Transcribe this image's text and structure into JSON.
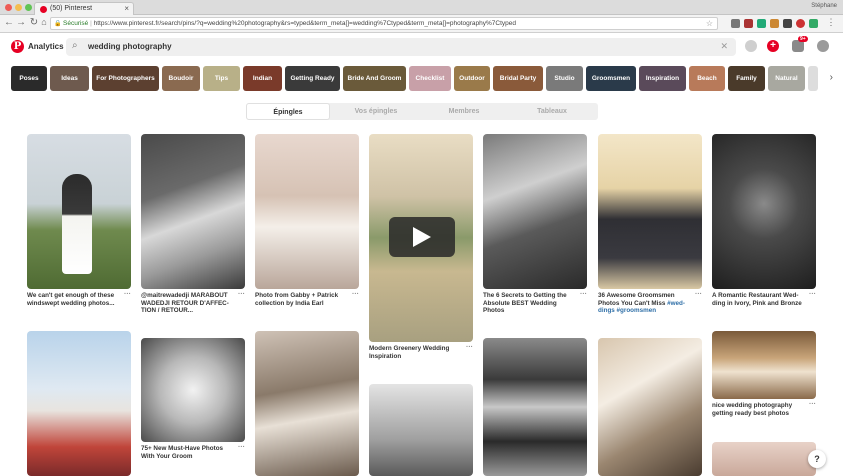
{
  "browser": {
    "tab_title": "(50) Pinterest",
    "user": "Stéphane",
    "secure_label": "Sécurisé",
    "url": "https://www.pinterest.fr/search/pins/?q=wedding%20photography&rs=typed&term_meta[]=wedding%7Ctyped&term_meta[]=photography%7Ctyped"
  },
  "header": {
    "analytics_label": "Analytics",
    "search_value": "wedding photography",
    "notification_badge": "9+"
  },
  "guides": [
    {
      "label": "Poses",
      "color": "#2a2a2a"
    },
    {
      "label": "Ideas",
      "color": "#6e5a4e"
    },
    {
      "label": "For Photographers",
      "color": "#5c4030"
    },
    {
      "label": "Boudoir",
      "color": "#8a6a50"
    },
    {
      "label": "Tips",
      "color": "#b8b088"
    },
    {
      "label": "Indian",
      "color": "#7a3a2a"
    },
    {
      "label": "Getting Ready",
      "color": "#3a3a3a"
    },
    {
      "label": "Bride And Groom",
      "color": "#6a5a3a"
    },
    {
      "label": "Checklist",
      "color": "#c8a0a8"
    },
    {
      "label": "Outdoor",
      "color": "#9a7a4a"
    },
    {
      "label": "Bridal Party",
      "color": "#8a5a3a"
    },
    {
      "label": "Studio",
      "color": "#7a7a7a"
    },
    {
      "label": "Groomsmen",
      "color": "#2a3a4a"
    },
    {
      "label": "Inspiration",
      "color": "#5a4a5a"
    },
    {
      "label": "Beach",
      "color": "#b87a5a"
    },
    {
      "label": "Family",
      "color": "#4a3a2a"
    },
    {
      "label": "Natural",
      "color": "#a8a8a0"
    }
  ],
  "tabs": [
    {
      "label": "Épingles",
      "active": true
    },
    {
      "label": "Vos épingles",
      "active": false
    },
    {
      "label": "Membres",
      "active": false
    },
    {
      "label": "Tableaux",
      "active": false
    }
  ],
  "pins": {
    "p1": {
      "desc": "We can't get enough of these windswept wedding photos..."
    },
    "p2": {
      "desc": "@maitrewadedji MARABOUT WADEDJI RETOUR D'AFFEC- TION / RETOUR..."
    },
    "p3": {
      "desc": "Photo from Gabby + Patrick collection by India Earl"
    },
    "p4": {
      "desc": "Modern Greenery Wedding Inspiration"
    },
    "p5": {
      "desc": "The 6 Secrets to Getting the Absolute BEST Wedding Photos"
    },
    "p6": {
      "desc": "36 Awesome Groomsmen Photos You Can't Miss",
      "tag": "#wed- dings #groomsmen"
    },
    "p7": {
      "desc": "A Romantic Restaurant Wed- ding in Ivory, Pink and Bronze"
    },
    "p8": {
      "desc": "75+ New Must-Have Photos With Your Groom"
    },
    "p9": {
      "desc": "nice wedding photography getting ready best photos"
    },
    "more_label": "···"
  },
  "help_label": "?"
}
